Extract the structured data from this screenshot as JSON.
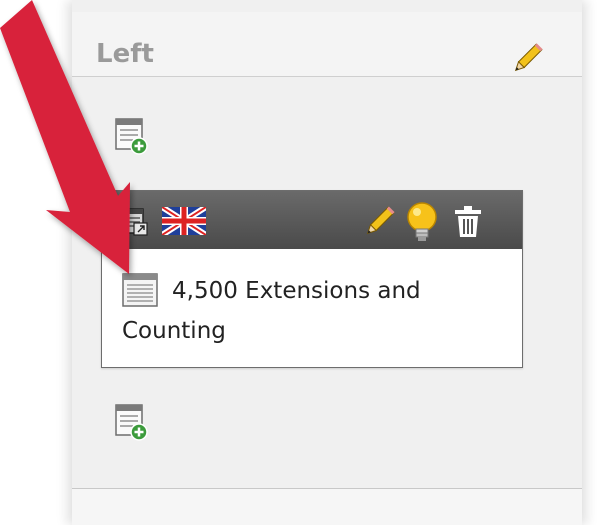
{
  "column": {
    "title": "Left",
    "edit_icon": "pencil-icon",
    "new_content_icon": "new-content-element-icon"
  },
  "content_element": {
    "type_icon": "text-content-type-icon",
    "language_flag": "uk-flag-icon",
    "actions": [
      {
        "icon": "pencil-icon",
        "name": "edit"
      },
      {
        "icon": "lightbulb-icon",
        "name": "hide"
      },
      {
        "icon": "trash-icon",
        "name": "delete"
      }
    ],
    "body_icon": "text-document-icon",
    "text": "4,500 Extensions and Counting"
  },
  "colors": {
    "arrow": "#d8203a",
    "toolbar": "#5a5a5a",
    "column_bg": "#f0f0f0",
    "title": "#9a9a9a"
  }
}
